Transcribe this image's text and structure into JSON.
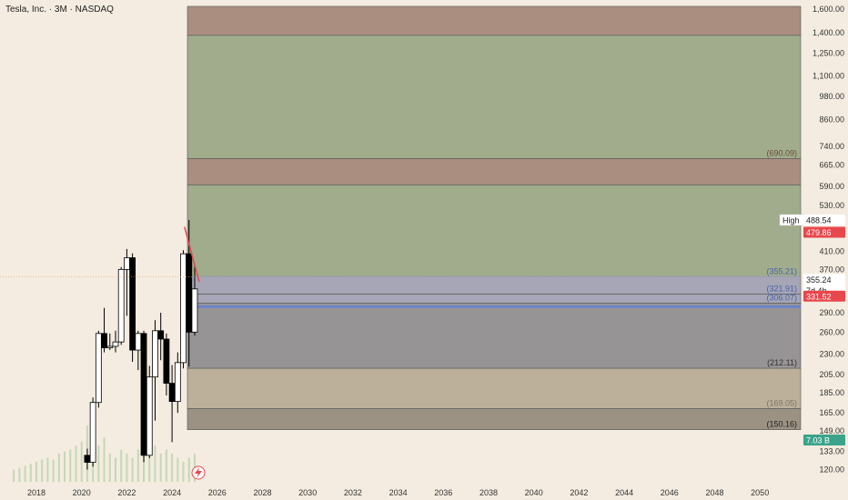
{
  "symbol_title": "Tesla, Inc. · 3M · NASDAQ",
  "price_axis": {
    "ticks": [
      "1,600.00",
      "1,400.00",
      "1,250.00",
      "1,100.00",
      "980.00",
      "860.00",
      "740.00",
      "665.00",
      "590.00",
      "530.00",
      "410.00",
      "370.00",
      "290.00",
      "260.00",
      "230.00",
      "205.00",
      "185.00",
      "165.00",
      "149.00",
      "133.00",
      "120.00"
    ]
  },
  "time_axis": {
    "ticks": [
      "2018",
      "2020",
      "2022",
      "2024",
      "2026",
      "2028",
      "2030",
      "2032",
      "2034",
      "2036",
      "2038",
      "2040",
      "2042",
      "2044",
      "2046",
      "2048",
      "2050"
    ]
  },
  "badges": {
    "high_label": "High",
    "high_value": "488.54",
    "last_price": "479.86",
    "countdown_price": "355.24",
    "countdown_time": "7d 4h",
    "current_price": "331.52",
    "volume": "7.03 B"
  },
  "colors": {
    "background": "#f4ece0",
    "up_candle": "#ffffff",
    "down_candle": "#000000",
    "green_zone": "#a0ac8c",
    "red_zone": "#aa8e80",
    "blue_zone": "#a6a6b6",
    "gray_zone": "#969494",
    "tan_zone": "#bcb09a",
    "dark_zone": "#9b9283",
    "last_price_badge": "#e8474d",
    "current_price_badge": "#e8474d",
    "volume_badge": "#3aa38a",
    "trendline": "#e8474d"
  },
  "chart_data": {
    "type": "candlestick",
    "title": "Tesla, Inc. · 3M · NASDAQ",
    "y_scale": "log",
    "ylim": [
      112,
      1650
    ],
    "xlim": [
      2016.75,
      2051.5
    ],
    "zone_labels": [
      "(690.09)",
      "(355.21)",
      "(321.91)",
      "(306.07)",
      "(212.11)",
      "(169.05)",
      "(150.16)"
    ],
    "zones": [
      {
        "name": "zone-top-red",
        "y_low": 1380,
        "y_high": 1625,
        "color": "red"
      },
      {
        "name": "zone-upper-green",
        "y_low": 690.09,
        "y_high": 1380,
        "color": "green"
      },
      {
        "name": "zone-mid-red",
        "y_low": 595,
        "y_high": 690.09,
        "color": "red"
      },
      {
        "name": "zone-lower-green",
        "y_low": 355.21,
        "y_high": 595,
        "color": "green"
      },
      {
        "name": "zone-blue",
        "y_low": 321.91,
        "y_high": 355.21,
        "color": "blue"
      },
      {
        "name": "zone-blue-inner",
        "y_low": 306.07,
        "y_high": 321.91,
        "color": "blue"
      },
      {
        "name": "zone-gray",
        "y_low": 212.11,
        "y_high": 306.07,
        "color": "gray"
      },
      {
        "name": "zone-tan",
        "y_low": 169.05,
        "y_high": 212.11,
        "color": "tan"
      },
      {
        "name": "zone-dark",
        "y_low": 150.16,
        "y_high": 169.05,
        "color": "dark"
      }
    ],
    "candles": [
      {
        "t": 2020.25,
        "o": 130,
        "h": 135,
        "l": 120,
        "c": 125
      },
      {
        "t": 2020.5,
        "o": 125,
        "h": 180,
        "l": 122,
        "c": 175
      },
      {
        "t": 2020.75,
        "o": 175,
        "h": 262,
        "l": 170,
        "c": 258
      },
      {
        "t": 2021.0,
        "o": 258,
        "h": 298,
        "l": 232,
        "c": 238
      },
      {
        "t": 2021.25,
        "o": 238,
        "h": 258,
        "l": 235,
        "c": 240
      },
      {
        "t": 2021.5,
        "o": 240,
        "h": 262,
        "l": 232,
        "c": 246
      },
      {
        "t": 2021.75,
        "o": 246,
        "h": 375,
        "l": 242,
        "c": 370
      },
      {
        "t": 2022.0,
        "o": 370,
        "h": 415,
        "l": 285,
        "c": 395
      },
      {
        "t": 2022.25,
        "o": 395,
        "h": 405,
        "l": 220,
        "c": 235
      },
      {
        "t": 2022.5,
        "o": 235,
        "h": 262,
        "l": 210,
        "c": 258
      },
      {
        "t": 2022.75,
        "o": 258,
        "h": 262,
        "l": 125,
        "c": 130
      },
      {
        "t": 2023.0,
        "o": 130,
        "h": 215,
        "l": 128,
        "c": 202
      },
      {
        "t": 2023.25,
        "o": 202,
        "h": 278,
        "l": 158,
        "c": 262
      },
      {
        "t": 2023.5,
        "o": 262,
        "h": 290,
        "l": 222,
        "c": 250
      },
      {
        "t": 2023.75,
        "o": 250,
        "h": 258,
        "l": 182,
        "c": 195
      },
      {
        "t": 2024.0,
        "o": 195,
        "h": 216,
        "l": 140,
        "c": 176
      },
      {
        "t": 2024.25,
        "o": 176,
        "h": 232,
        "l": 165,
        "c": 219
      },
      {
        "t": 2024.5,
        "o": 219,
        "h": 412,
        "l": 212,
        "c": 404
      },
      {
        "t": 2024.75,
        "o": 404,
        "h": 488.54,
        "l": 214,
        "c": 260
      },
      {
        "t": 2025.0,
        "o": 260,
        "h": 380,
        "l": 255,
        "c": 331.52
      }
    ],
    "volume": [
      {
        "t": 2017.0,
        "v": 0.3
      },
      {
        "t": 2017.25,
        "v": 0.35
      },
      {
        "t": 2017.5,
        "v": 0.4
      },
      {
        "t": 2017.75,
        "v": 0.45
      },
      {
        "t": 2018.0,
        "v": 0.5
      },
      {
        "t": 2018.25,
        "v": 0.55
      },
      {
        "t": 2018.5,
        "v": 0.6
      },
      {
        "t": 2018.75,
        "v": 0.55
      },
      {
        "t": 2019.0,
        "v": 0.7
      },
      {
        "t": 2019.25,
        "v": 0.75
      },
      {
        "t": 2019.5,
        "v": 0.8
      },
      {
        "t": 2019.75,
        "v": 0.9
      },
      {
        "t": 2020.0,
        "v": 1.0
      },
      {
        "t": 2020.25,
        "v": 1.4
      },
      {
        "t": 2020.5,
        "v": 1.3
      },
      {
        "t": 2020.75,
        "v": 0.9
      },
      {
        "t": 2021.0,
        "v": 1.1
      },
      {
        "t": 2021.25,
        "v": 0.7
      },
      {
        "t": 2021.5,
        "v": 0.6
      },
      {
        "t": 2021.75,
        "v": 0.8
      },
      {
        "t": 2022.0,
        "v": 0.7
      },
      {
        "t": 2022.25,
        "v": 0.6
      },
      {
        "t": 2022.5,
        "v": 0.8
      },
      {
        "t": 2022.75,
        "v": 0.9
      },
      {
        "t": 2023.0,
        "v": 1.2
      },
      {
        "t": 2023.25,
        "v": 0.9
      },
      {
        "t": 2023.5,
        "v": 0.7
      },
      {
        "t": 2023.75,
        "v": 0.8
      },
      {
        "t": 2024.0,
        "v": 0.7
      },
      {
        "t": 2024.25,
        "v": 0.6
      },
      {
        "t": 2024.5,
        "v": 0.5
      },
      {
        "t": 2024.75,
        "v": 0.6
      },
      {
        "t": 2025.0,
        "v": 0.7
      }
    ],
    "trendline": [
      {
        "t": 2024.55,
        "p": 470
      },
      {
        "t": 2025.2,
        "p": 345
      }
    ]
  }
}
